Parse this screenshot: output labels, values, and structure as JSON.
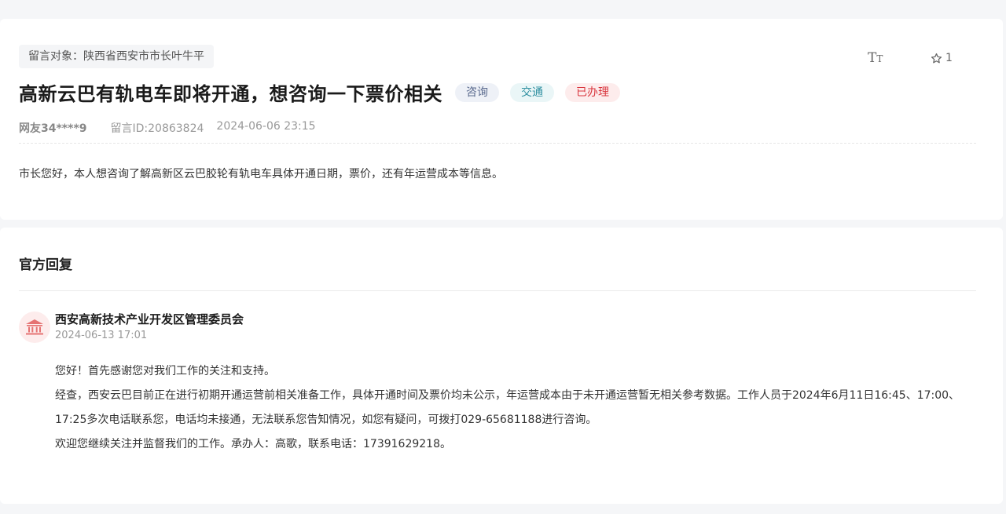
{
  "message": {
    "target_label": "留言对象：陕西省西安市市长叶牛平",
    "font_toggle": {
      "big": "T",
      "small": "T"
    },
    "favorite_count": "1",
    "title": "高新云巴有轨电车即将开通，想咨询一下票价相关",
    "tags": [
      "咨询",
      "交通",
      "已办理"
    ],
    "user": "网友34****9",
    "message_id": "留言ID:20863824",
    "datetime": "2024-06-06 23:15",
    "content": "市长您好，本人想咨询了解高新区云巴胶轮有轨电车具体开通日期，票价，还有年运营成本等信息。"
  },
  "reply": {
    "heading": "官方回复",
    "org": "西安高新技术产业开发区管理委员会",
    "datetime": "2024-06-13 17:01",
    "paragraphs": [
      "您好！首先感谢您对我们工作的关注和支持。",
      "经查，西安云巴目前正在进行初期开通运营前相关准备工作，具体开通时间及票价均未公示，年运营成本由于未开通运营暂无相关参考数据。工作人员于2024年6月11日16:45、17:00、17:25多次电话联系您，电话均未接通，无法联系您告知情况，如您有疑问，可拨打029-65681188进行咨询。",
      "欢迎您继续关注并监督我们的工作。承办人：高歌，联系电话：17391629218。"
    ]
  },
  "colors": {
    "tag_consult": "#5a6a8e",
    "tag_traffic": "#2e8fa0",
    "tag_done": "#d9363e",
    "avatar_bg": "#fdecec",
    "avatar_icon": "#e57373"
  }
}
